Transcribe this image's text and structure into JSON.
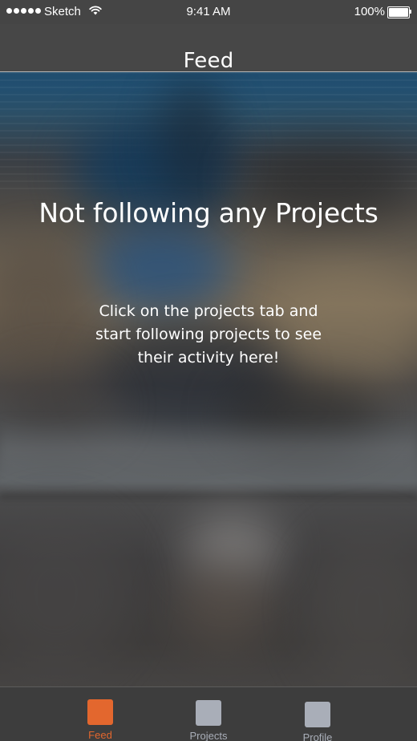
{
  "status_bar": {
    "carrier": "Sketch",
    "time": "9:41 AM",
    "battery_percent": "100%",
    "battery_level": 1.0,
    "signal_bars": 5,
    "wifi_icon": "wifi-icon"
  },
  "nav": {
    "title": "Feed"
  },
  "empty_state": {
    "title": "Not following any Projects",
    "message": "Click on the projects tab and start following projects to see their activity here!"
  },
  "tab_bar": {
    "tabs": [
      {
        "label": "Feed",
        "icon": "feed-tab-icon",
        "active": true
      },
      {
        "label": "Projects",
        "icon": "projects-tab-icon",
        "active": false
      },
      {
        "label": "Profile",
        "icon": "profile-tab-icon",
        "active": false
      }
    ]
  },
  "colors": {
    "accent": "#e3672e",
    "inactive_tab": "#a9aeb8",
    "nav_background": "#474747",
    "tab_bar_background": "#3d3d3d"
  }
}
